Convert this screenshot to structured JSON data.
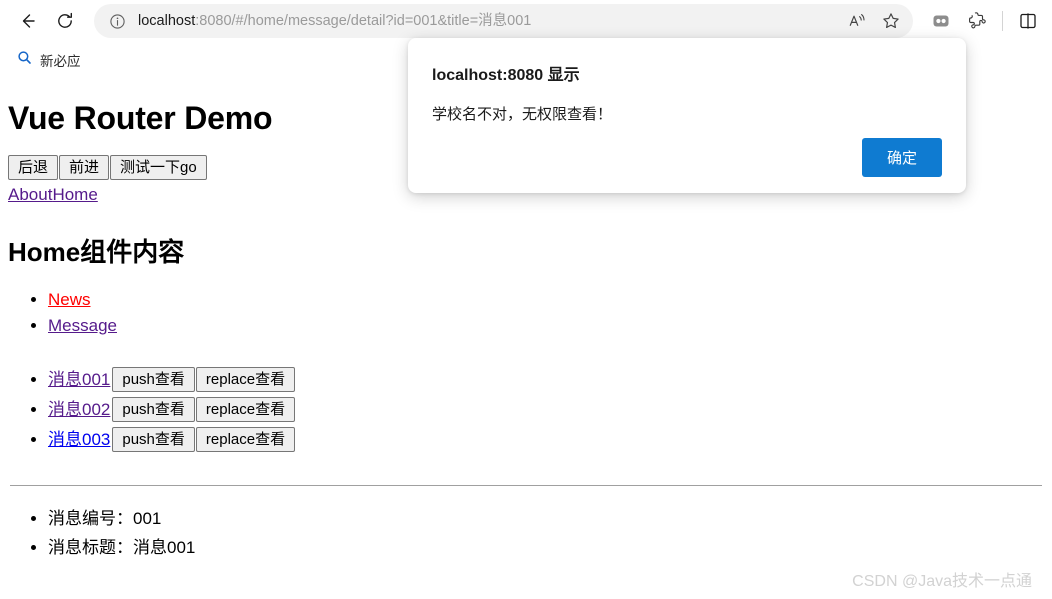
{
  "browser": {
    "back_label": "Back",
    "reload_label": "Refresh",
    "url": {
      "host": "localhost",
      "rest": ":8080/#/home/message/detail?id=001&title=消息001",
      "full": "localhost:8080/#/home/message/detail?id=001&title=消息001",
      "info_icon": "info-icon"
    },
    "actions": [
      {
        "name": "read-aloud-icon",
        "label": "Read aloud"
      },
      {
        "name": "favorites-star-icon",
        "label": "Add to favorites"
      }
    ],
    "right_icons": [
      {
        "name": "browser-essentials-icon",
        "label": "Browser essentials"
      },
      {
        "name": "extensions-puzzle-icon",
        "label": "Extensions"
      },
      {
        "name": "split-screen-icon",
        "label": "Split screen"
      }
    ],
    "bookmarks": [
      {
        "icon": "search-icon",
        "label": "新必应"
      }
    ]
  },
  "page": {
    "title": "Vue Router Demo",
    "nav_buttons": [
      {
        "label": "后退"
      },
      {
        "label": "前进"
      },
      {
        "label": "测试一下go"
      }
    ],
    "top_links": [
      {
        "label": "About",
        "state": "visited"
      },
      {
        "label": "Home",
        "state": "visited"
      }
    ],
    "section_title": "Home组件内容",
    "sub_links": [
      {
        "label": "News",
        "state": "active"
      },
      {
        "label": "Message",
        "state": "visited"
      }
    ],
    "messages": [
      {
        "label": "消息001",
        "state": "visited",
        "push_label": "push查看",
        "replace_label": "replace查看"
      },
      {
        "label": "消息002",
        "state": "visited",
        "push_label": "push查看",
        "replace_label": "replace查看"
      },
      {
        "label": "消息003",
        "state": "unvisited",
        "push_label": "push查看",
        "replace_label": "replace查看"
      }
    ],
    "detail": [
      {
        "label": "消息编号：001"
      },
      {
        "label": "消息标题：消息001"
      }
    ],
    "watermark": "CSDN @Java技术一点通"
  },
  "dialog": {
    "title": "localhost:8080 显示",
    "message": "学校名不对，无权限查看！",
    "confirm_label": "确定",
    "accent_color": "#0f7bd1"
  }
}
